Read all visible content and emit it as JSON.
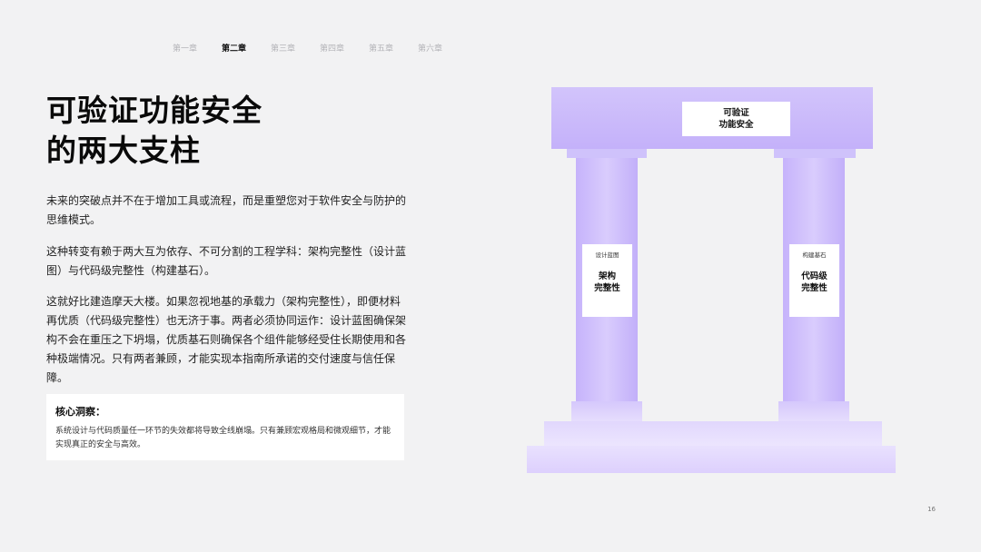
{
  "nav": {
    "items": [
      "第一章",
      "第二章",
      "第三章",
      "第四章",
      "第五章",
      "第六章"
    ],
    "active_index": 1
  },
  "title": {
    "line1": "可验证功能安全",
    "line2": "的两大支柱"
  },
  "paragraphs": [
    "未来的突破点并不在于增加工具或流程，而是重塑您对于软件安全与防护的思维模式。",
    "这种转变有赖于两大互为依存、不可分割的工程学科：架构完整性（设计蓝图）与代码级完整性（构建基石）。",
    "这就好比建造摩天大楼。如果忽视地基的承载力（架构完整性），即便材料再优质（代码级完整性）也无济于事。两者必须协同运作：设计蓝图确保架构不会在重压之下坍塌，优质基石则确保各个组件能够经受住长期使用和各种极端情况。只有两者兼顾，才能实现本指南所承诺的交付速度与信任保障。"
  ],
  "insight": {
    "title": "核心洞察：",
    "body": "系统设计与代码质量任一环节的失效都将导致全线崩塌。只有兼顾宏观格局和微观细节，才能实现真正的安全与高效。"
  },
  "temple": {
    "beam_line1": "可验证",
    "beam_line2": "功能安全",
    "left_small": "设计蓝图",
    "left_big1": "架构",
    "left_big2": "完整性",
    "right_small": "构建基石",
    "right_big1": "代码级",
    "right_big2": "完整性",
    "accent_color": "#c4b1fa"
  },
  "page_number": "16"
}
